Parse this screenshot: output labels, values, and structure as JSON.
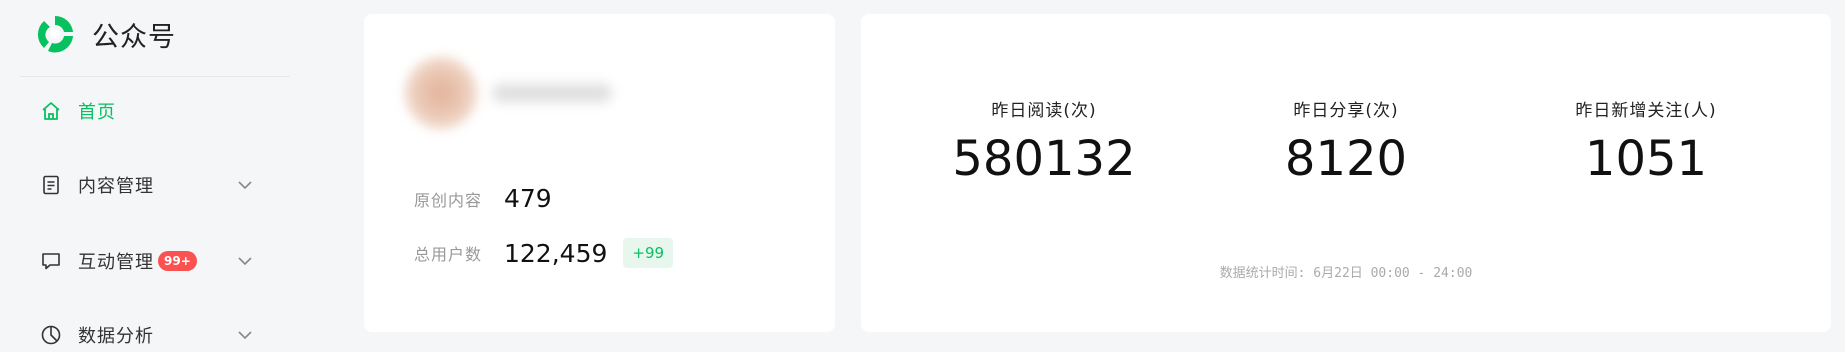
{
  "brand": {
    "name": "公众号"
  },
  "nav": {
    "items": [
      {
        "label": "首页",
        "icon": "home-icon",
        "active": true
      },
      {
        "label": "内容管理",
        "icon": "document-icon"
      },
      {
        "label": "互动管理",
        "icon": "message-icon",
        "badge": "99+"
      },
      {
        "label": "数据分析",
        "icon": "pie-chart-icon"
      }
    ]
  },
  "account": {
    "rows": [
      {
        "label": "原创内容",
        "value": "479"
      },
      {
        "label": "总用户数",
        "value": "122,459",
        "delta": "+99"
      }
    ]
  },
  "stats": {
    "items": [
      {
        "label": "昨日阅读(次)",
        "value": "580132"
      },
      {
        "label": "昨日分享(次)",
        "value": "8120"
      },
      {
        "label": "昨日新增关注(人)",
        "value": "1051"
      }
    ],
    "footer": "数据统计时间: 6月22日 00:00 - 24:00"
  },
  "colors": {
    "accent": "#07c160",
    "badge": "#fa5151",
    "background": "#f5f6f8"
  }
}
